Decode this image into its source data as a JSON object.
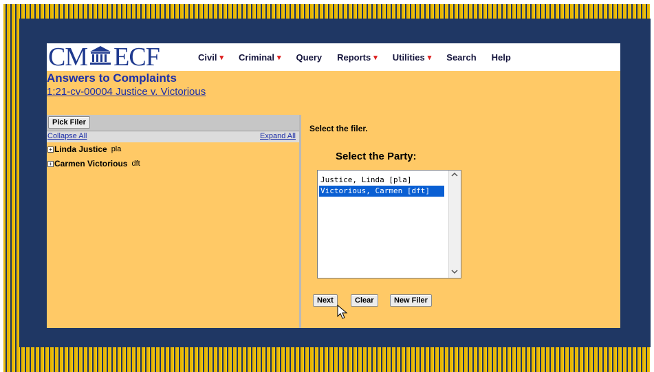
{
  "logo": {
    "left": "CM",
    "right": "ECF"
  },
  "menu": [
    {
      "label": "Civil",
      "underline_char": "",
      "dropdown": true
    },
    {
      "label": "Criminal",
      "dropdown": true
    },
    {
      "label": "Query",
      "dropdown": false
    },
    {
      "label": "Reports",
      "dropdown": true
    },
    {
      "label": "Utilities",
      "dropdown": true
    },
    {
      "label": "Search",
      "dropdown": false
    },
    {
      "label": "Help",
      "dropdown": false
    }
  ],
  "page": {
    "title": "Answers to Complaints",
    "case_link": "1:21-cv-00004 Justice v. Victorious"
  },
  "left_pane": {
    "pick_filer_button": "Pick Filer",
    "collapse_all": "Collapse All",
    "expand_all": "Expand All",
    "tree": [
      {
        "name": "Linda Justice",
        "role": "pla"
      },
      {
        "name": "Carmen Victorious",
        "role": "dft"
      }
    ]
  },
  "right_pane": {
    "instruction": "Select the filer.",
    "party_heading": "Select the Party:",
    "party_options": [
      {
        "label": "Justice, Linda [pla]",
        "selected": false
      },
      {
        "label": "Victorious, Carmen [dft]",
        "selected": true
      }
    ],
    "buttons": {
      "next": "Next",
      "clear": "Clear",
      "new_filer": "New Filer"
    }
  },
  "colors": {
    "frame_gold": "#e6b400",
    "frame_navy": "#1f3764",
    "app_background": "#ffc966",
    "link_blue": "#1d2fa8",
    "selection_blue": "#0a5fd3",
    "menu_caret_red": "#dd2222"
  },
  "icons": [
    "seal-icon",
    "caret-down-icon",
    "tree-expand-icon",
    "scroll-up-icon",
    "scroll-down-icon",
    "mouse-pointer-icon"
  ]
}
